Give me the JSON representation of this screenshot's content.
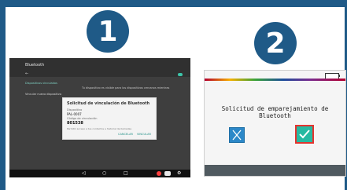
{
  "colors": {
    "frame": "#1f5a87",
    "badge": "#1f5a87",
    "cancel_button": "#2c88c8",
    "confirm_button": "#27b9a1",
    "confirm_border": "#e3342f",
    "android_accent": "#3cc4a9"
  },
  "steps": [
    {
      "number": "1"
    },
    {
      "number": "2"
    }
  ],
  "android_screen": {
    "app_title": "Bluetooth",
    "back": "←",
    "section_link": "Dispositivos vinculados",
    "body_row": "Vincular nuevo dispositivo",
    "notice": "Tu dispositivo es visible para los dispositivos cercanos mientras",
    "dialog": {
      "title": "Solicitud de vinculación de Bluetooth",
      "device_label": "Dispositivo",
      "device_name": "PAL-0007",
      "code_label": "Código de vinculación",
      "code": "801538",
      "help_text": "Permitir acceso a tus contactos e historial de llamadas",
      "cancel_label": "CANCELAR",
      "pair_label": "VINCULAR"
    },
    "nav_icons": {
      "back": "◁",
      "home": "○",
      "recent": "□",
      "settings": "⚙"
    }
  },
  "device_screen": {
    "request_title": "Solicitud de emparejamiento de Bluetooth",
    "cancel_icon": "x-icon",
    "confirm_icon": "check-icon"
  }
}
